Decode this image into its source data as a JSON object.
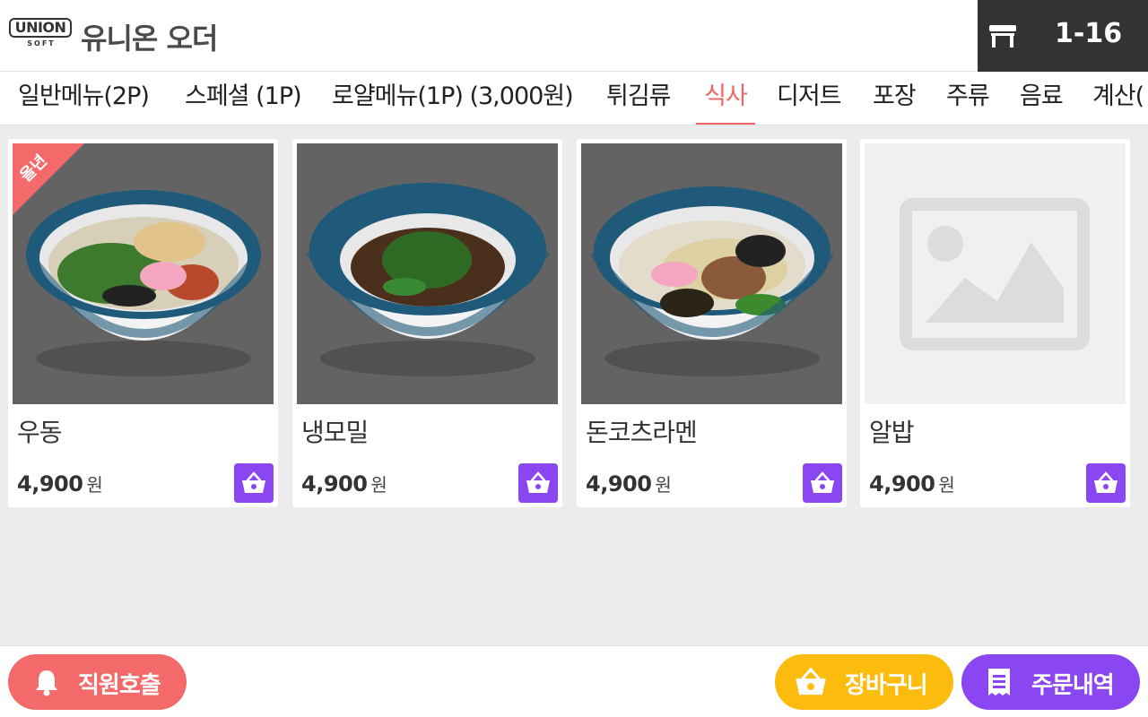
{
  "header": {
    "logo_text": "UNION",
    "logo_subtext": "SOFT",
    "app_title": "유니온 오더",
    "table_number": "1-16",
    "table_icon": "table-icon"
  },
  "tabs": [
    {
      "label": "일반메뉴(2P)",
      "active": false
    },
    {
      "label": "스페셜 (1P)",
      "active": false
    },
    {
      "label": "로얄메뉴(1P) (3,000원)",
      "active": false
    },
    {
      "label": "튀김류",
      "active": false
    },
    {
      "label": "식사",
      "active": true
    },
    {
      "label": "디저트",
      "active": false
    },
    {
      "label": "포장",
      "active": false
    },
    {
      "label": "주류",
      "active": false
    },
    {
      "label": "음료",
      "active": false
    },
    {
      "label": "계산(",
      "active": false
    }
  ],
  "menu_items": [
    {
      "name": "우동",
      "price": "4,900",
      "currency": "원",
      "image": "udon-bowl",
      "badge": "올년"
    },
    {
      "name": "냉모밀",
      "price": "4,900",
      "currency": "원",
      "image": "cold-soba-bowl",
      "badge": ""
    },
    {
      "name": "돈코츠라멘",
      "price": "4,900",
      "currency": "원",
      "image": "tonkotsu-ramen-bowl",
      "badge": ""
    },
    {
      "name": "알밥",
      "price": "4,900",
      "currency": "원",
      "image": "image-placeholder",
      "badge": ""
    }
  ],
  "footer": {
    "staff_call_label": "직원호출",
    "cart_label": "장바구니",
    "orders_label": "주문내역"
  },
  "colors": {
    "accent_red": "#f06565",
    "purple": "#8a46f0",
    "yellow": "#fbbc0d",
    "header_dark": "#333333"
  }
}
